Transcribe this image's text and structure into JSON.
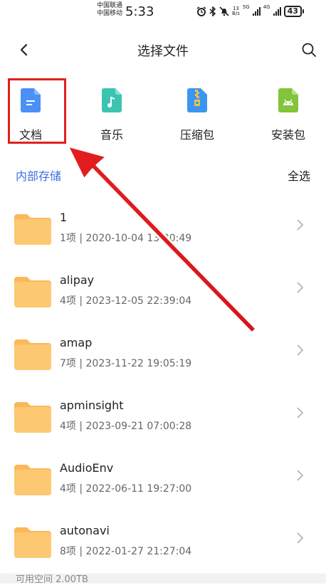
{
  "status_bar": {
    "carrier_1": "中国联通",
    "carrier_2": "中国移动",
    "time": "5:33",
    "speed_value": "13",
    "speed_unit": "B/s",
    "net_1": "5G",
    "net_2": "4G",
    "battery": "43"
  },
  "header": {
    "title": "选择文件"
  },
  "categories": [
    {
      "label": "文档",
      "icon": "document-icon",
      "color": "#4a90f5"
    },
    {
      "label": "音乐",
      "icon": "music-icon",
      "color": "#3cc4b0"
    },
    {
      "label": "压缩包",
      "icon": "zip-icon",
      "color": "#3a96f0"
    },
    {
      "label": "安装包",
      "icon": "android-icon",
      "color": "#82c43a"
    }
  ],
  "section": {
    "storage_label": "内部存储",
    "select_all": "全选"
  },
  "files": [
    {
      "name": "1",
      "meta": "1项 | 2020-10-04 13:30:49"
    },
    {
      "name": "alipay",
      "meta": "4项 | 2023-12-05 22:39:04"
    },
    {
      "name": "amap",
      "meta": "7项 | 2023-11-22 19:05:19"
    },
    {
      "name": "apminsight",
      "meta": "4项 | 2023-09-21 07:00:28"
    },
    {
      "name": "AudioEnv",
      "meta": "4项 | 2022-06-11 19:27:00"
    },
    {
      "name": "autonavi",
      "meta": "8项 | 2022-01-27 21:27:04"
    }
  ],
  "footer": {
    "available_space": "可用空间 2.00TB"
  },
  "colors": {
    "accent": "#3d6fe0",
    "highlight": "#e1201a",
    "folder": "#fcc46a"
  }
}
